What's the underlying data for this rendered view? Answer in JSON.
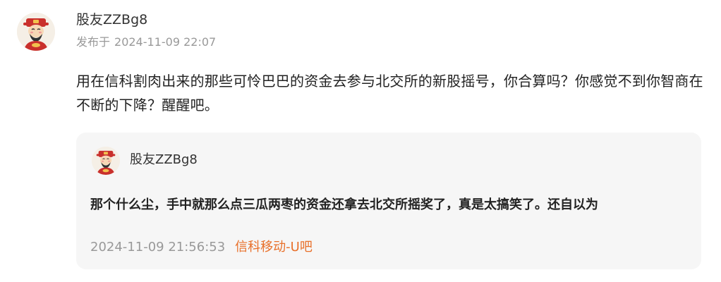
{
  "post": {
    "author": "股友ZZBg8",
    "published_prefix": "发布于",
    "published_time": "2024-11-09 22:07",
    "content": "用在信科割肉出来的那些可怜巴巴的资金去参与北交所的新股摇号，你合算吗？你感觉不到你智商在不断的下降？醒醒吧。",
    "avatar_icon": "fortune-god-avatar-icon"
  },
  "quote": {
    "author": "股友ZZBg8",
    "text": "那个什么尘，手中就那么点三瓜两枣的资金还拿去北交所摇奖了，真是太搞笑了。还自以为",
    "time": "2024-11-09 21:56:53",
    "bar_name": "信科移动-U吧",
    "avatar_icon": "fortune-god-avatar-icon"
  },
  "colors": {
    "accent": "#e8702a",
    "meta": "#999999",
    "quote_bg": "#f6f6f6"
  }
}
